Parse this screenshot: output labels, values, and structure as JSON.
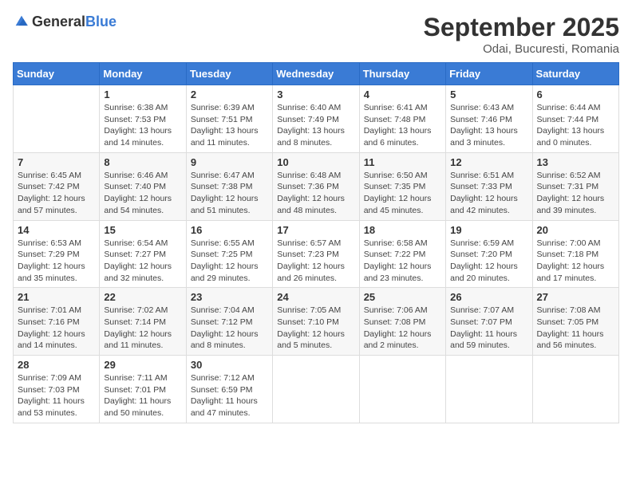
{
  "header": {
    "logo_general": "General",
    "logo_blue": "Blue",
    "month": "September 2025",
    "location": "Odai, Bucuresti, Romania"
  },
  "weekdays": [
    "Sunday",
    "Monday",
    "Tuesday",
    "Wednesday",
    "Thursday",
    "Friday",
    "Saturday"
  ],
  "weeks": [
    [
      {
        "day": "",
        "info": ""
      },
      {
        "day": "1",
        "info": "Sunrise: 6:38 AM\nSunset: 7:53 PM\nDaylight: 13 hours\nand 14 minutes."
      },
      {
        "day": "2",
        "info": "Sunrise: 6:39 AM\nSunset: 7:51 PM\nDaylight: 13 hours\nand 11 minutes."
      },
      {
        "day": "3",
        "info": "Sunrise: 6:40 AM\nSunset: 7:49 PM\nDaylight: 13 hours\nand 8 minutes."
      },
      {
        "day": "4",
        "info": "Sunrise: 6:41 AM\nSunset: 7:48 PM\nDaylight: 13 hours\nand 6 minutes."
      },
      {
        "day": "5",
        "info": "Sunrise: 6:43 AM\nSunset: 7:46 PM\nDaylight: 13 hours\nand 3 minutes."
      },
      {
        "day": "6",
        "info": "Sunrise: 6:44 AM\nSunset: 7:44 PM\nDaylight: 13 hours\nand 0 minutes."
      }
    ],
    [
      {
        "day": "7",
        "info": "Sunrise: 6:45 AM\nSunset: 7:42 PM\nDaylight: 12 hours\nand 57 minutes."
      },
      {
        "day": "8",
        "info": "Sunrise: 6:46 AM\nSunset: 7:40 PM\nDaylight: 12 hours\nand 54 minutes."
      },
      {
        "day": "9",
        "info": "Sunrise: 6:47 AM\nSunset: 7:38 PM\nDaylight: 12 hours\nand 51 minutes."
      },
      {
        "day": "10",
        "info": "Sunrise: 6:48 AM\nSunset: 7:36 PM\nDaylight: 12 hours\nand 48 minutes."
      },
      {
        "day": "11",
        "info": "Sunrise: 6:50 AM\nSunset: 7:35 PM\nDaylight: 12 hours\nand 45 minutes."
      },
      {
        "day": "12",
        "info": "Sunrise: 6:51 AM\nSunset: 7:33 PM\nDaylight: 12 hours\nand 42 minutes."
      },
      {
        "day": "13",
        "info": "Sunrise: 6:52 AM\nSunset: 7:31 PM\nDaylight: 12 hours\nand 39 minutes."
      }
    ],
    [
      {
        "day": "14",
        "info": "Sunrise: 6:53 AM\nSunset: 7:29 PM\nDaylight: 12 hours\nand 35 minutes."
      },
      {
        "day": "15",
        "info": "Sunrise: 6:54 AM\nSunset: 7:27 PM\nDaylight: 12 hours\nand 32 minutes."
      },
      {
        "day": "16",
        "info": "Sunrise: 6:55 AM\nSunset: 7:25 PM\nDaylight: 12 hours\nand 29 minutes."
      },
      {
        "day": "17",
        "info": "Sunrise: 6:57 AM\nSunset: 7:23 PM\nDaylight: 12 hours\nand 26 minutes."
      },
      {
        "day": "18",
        "info": "Sunrise: 6:58 AM\nSunset: 7:22 PM\nDaylight: 12 hours\nand 23 minutes."
      },
      {
        "day": "19",
        "info": "Sunrise: 6:59 AM\nSunset: 7:20 PM\nDaylight: 12 hours\nand 20 minutes."
      },
      {
        "day": "20",
        "info": "Sunrise: 7:00 AM\nSunset: 7:18 PM\nDaylight: 12 hours\nand 17 minutes."
      }
    ],
    [
      {
        "day": "21",
        "info": "Sunrise: 7:01 AM\nSunset: 7:16 PM\nDaylight: 12 hours\nand 14 minutes."
      },
      {
        "day": "22",
        "info": "Sunrise: 7:02 AM\nSunset: 7:14 PM\nDaylight: 12 hours\nand 11 minutes."
      },
      {
        "day": "23",
        "info": "Sunrise: 7:04 AM\nSunset: 7:12 PM\nDaylight: 12 hours\nand 8 minutes."
      },
      {
        "day": "24",
        "info": "Sunrise: 7:05 AM\nSunset: 7:10 PM\nDaylight: 12 hours\nand 5 minutes."
      },
      {
        "day": "25",
        "info": "Sunrise: 7:06 AM\nSunset: 7:08 PM\nDaylight: 12 hours\nand 2 minutes."
      },
      {
        "day": "26",
        "info": "Sunrise: 7:07 AM\nSunset: 7:07 PM\nDaylight: 11 hours\nand 59 minutes."
      },
      {
        "day": "27",
        "info": "Sunrise: 7:08 AM\nSunset: 7:05 PM\nDaylight: 11 hours\nand 56 minutes."
      }
    ],
    [
      {
        "day": "28",
        "info": "Sunrise: 7:09 AM\nSunset: 7:03 PM\nDaylight: 11 hours\nand 53 minutes."
      },
      {
        "day": "29",
        "info": "Sunrise: 7:11 AM\nSunset: 7:01 PM\nDaylight: 11 hours\nand 50 minutes."
      },
      {
        "day": "30",
        "info": "Sunrise: 7:12 AM\nSunset: 6:59 PM\nDaylight: 11 hours\nand 47 minutes."
      },
      {
        "day": "",
        "info": ""
      },
      {
        "day": "",
        "info": ""
      },
      {
        "day": "",
        "info": ""
      },
      {
        "day": "",
        "info": ""
      }
    ]
  ]
}
